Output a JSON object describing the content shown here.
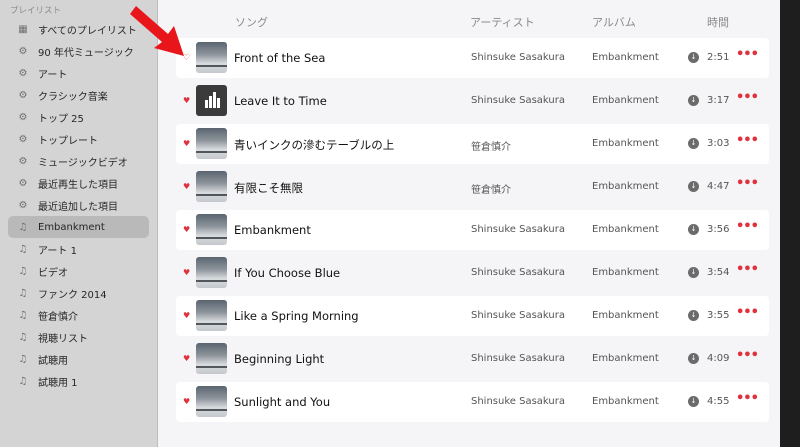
{
  "sidebar": {
    "header": "プレイリスト",
    "items": [
      {
        "label": "すべてのプレイリスト",
        "icon": "grid-icon",
        "selected": false
      },
      {
        "label": "90 年代ミュージック",
        "icon": "gear-icon",
        "selected": false
      },
      {
        "label": "アート",
        "icon": "gear-icon",
        "selected": false
      },
      {
        "label": "クラシック音楽",
        "icon": "gear-icon",
        "selected": false
      },
      {
        "label": "トップ 25",
        "icon": "gear-icon",
        "selected": false
      },
      {
        "label": "トップレート",
        "icon": "gear-icon",
        "selected": false
      },
      {
        "label": "ミュージックビデオ",
        "icon": "gear-icon",
        "selected": false
      },
      {
        "label": "最近再生した項目",
        "icon": "gear-icon",
        "selected": false
      },
      {
        "label": "最近追加した項目",
        "icon": "gear-icon",
        "selected": false
      },
      {
        "label": "Embankment",
        "icon": "playlist-icon",
        "selected": true
      },
      {
        "label": "アート 1",
        "icon": "playlist-icon",
        "selected": false
      },
      {
        "label": "ビデオ",
        "icon": "playlist-icon",
        "selected": false
      },
      {
        "label": "ファンク 2014",
        "icon": "playlist-icon",
        "selected": false
      },
      {
        "label": "笹倉慎介",
        "icon": "playlist-icon",
        "selected": false
      },
      {
        "label": "視聴リスト",
        "icon": "playlist-icon",
        "selected": false
      },
      {
        "label": "試聴用",
        "icon": "playlist-icon",
        "selected": false
      },
      {
        "label": "試聴用 1",
        "icon": "playlist-icon",
        "selected": false
      }
    ]
  },
  "columns": {
    "song": "ソング",
    "artist": "アーティスト",
    "album": "アルバム",
    "time": "時間"
  },
  "tracks": [
    {
      "title": "Front of the Sea",
      "artist": "Shinsuke Sasakura",
      "album": "Embankment",
      "time": "2:51",
      "favorite": false,
      "artwork": "album-art"
    },
    {
      "title": "Leave It to Time",
      "artist": "Shinsuke Sasakura",
      "album": "Embankment",
      "time": "3:17",
      "favorite": true,
      "artwork": "bars-art"
    },
    {
      "title": "青いインクの滲むテーブルの上",
      "artist": "笹倉慎介",
      "album": "Embankment",
      "time": "3:03",
      "favorite": true,
      "artwork": "album-art"
    },
    {
      "title": "有限こそ無限",
      "artist": "笹倉慎介",
      "album": "Embankment",
      "time": "4:47",
      "favorite": true,
      "artwork": "album-art"
    },
    {
      "title": "Embankment",
      "artist": "Shinsuke Sasakura",
      "album": "Embankment",
      "time": "3:56",
      "favorite": true,
      "artwork": "album-art"
    },
    {
      "title": "If You Choose Blue",
      "artist": "Shinsuke Sasakura",
      "album": "Embankment",
      "time": "3:54",
      "favorite": true,
      "artwork": "album-art"
    },
    {
      "title": "Like a Spring Morning",
      "artist": "Shinsuke Sasakura",
      "album": "Embankment",
      "time": "3:55",
      "favorite": true,
      "artwork": "album-art"
    },
    {
      "title": "Beginning Light",
      "artist": "Shinsuke Sasakura",
      "album": "Embankment",
      "time": "4:09",
      "favorite": true,
      "artwork": "album-art"
    },
    {
      "title": "Sunlight and You",
      "artist": "Shinsuke Sasakura",
      "album": "Embankment",
      "time": "4:55",
      "favorite": true,
      "artwork": "album-art"
    }
  ],
  "colors": {
    "accent": "#e0323e",
    "annotation_arrow": "#e8151b",
    "row_alt": "#ffffff",
    "main_bg": "#f5f5f7",
    "sidebar_bg": "#d4d4d4"
  }
}
